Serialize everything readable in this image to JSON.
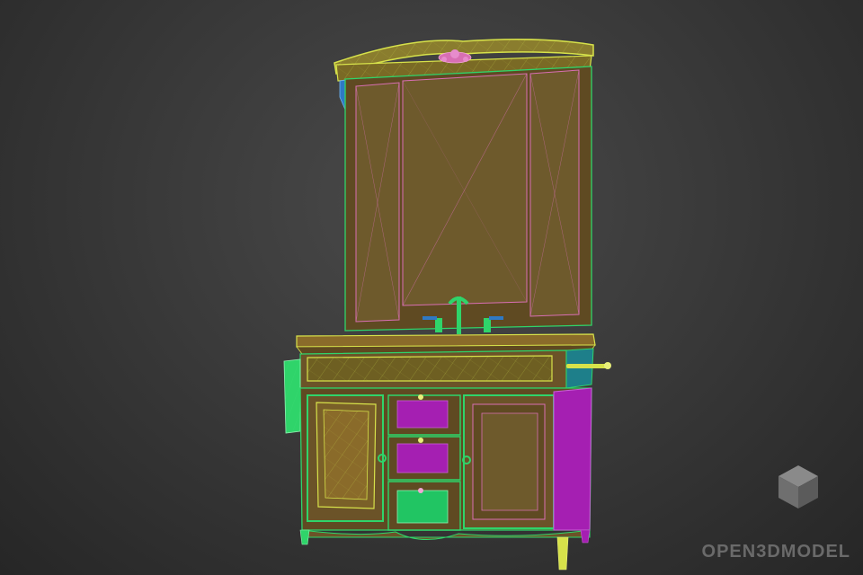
{
  "scene": {
    "subject": "vanity-cabinet-with-mirror",
    "render_mode": "wireframe-over-shaded",
    "background_color": "#3a3a3a",
    "colors": {
      "wood": "#6b5328",
      "wood_dark": "#574420",
      "wire_yellow": "#d7e24a",
      "wire_green": "#2fd46a",
      "wire_pink": "#d86fb3",
      "magenta": "#a51fb2",
      "teal": "#1e7f8a",
      "blue_bracket": "#2f79c4"
    }
  },
  "watermark": {
    "text": "OPEN3DMODEL",
    "icon": "cube-logo-icon"
  }
}
